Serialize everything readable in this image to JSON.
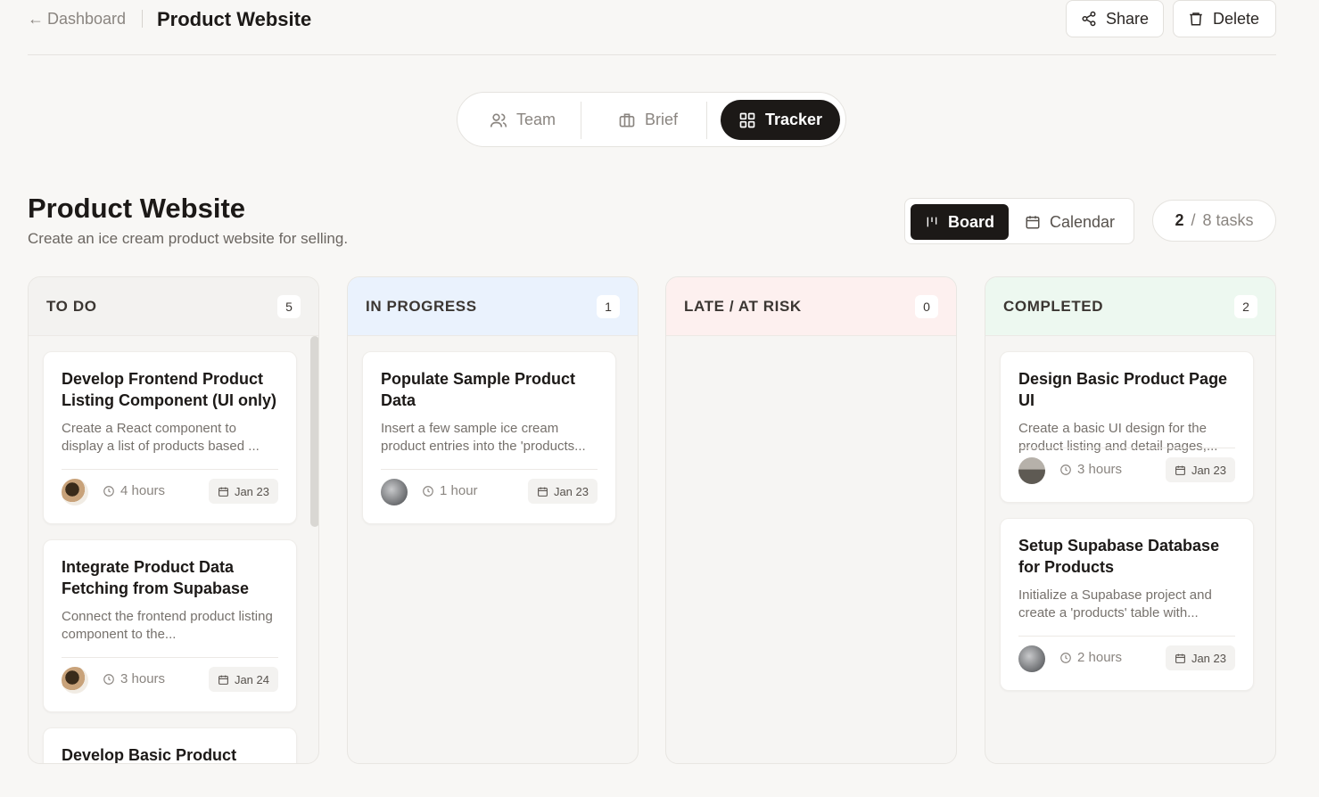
{
  "header": {
    "back_label": "Dashboard",
    "title": "Product Website",
    "share_label": "Share",
    "delete_label": "Delete"
  },
  "tabs": [
    {
      "label": "Team",
      "icon": "users-icon"
    },
    {
      "label": "Brief",
      "icon": "briefcase-icon"
    },
    {
      "label": "Tracker",
      "icon": "grid-icon",
      "active": true
    }
  ],
  "project": {
    "title": "Product Website",
    "description": "Create an ice cream product website for selling."
  },
  "views": {
    "board_label": "Board",
    "calendar_label": "Calendar",
    "active": "Board"
  },
  "task_count": {
    "done": "2",
    "separator": "/",
    "total": "8 tasks"
  },
  "columns": [
    {
      "title": "TO DO",
      "count": "5",
      "color": "#f3f2f0",
      "cards": [
        {
          "title": "Develop Frontend Product Listing Component (UI only)",
          "desc": "Create a React component to display a list of products based ...",
          "hours": "4 hours",
          "date": "Jan 23",
          "avatar": "food"
        },
        {
          "title": "Integrate Product Data Fetching from Supabase",
          "desc": "Connect the frontend product listing component to the...",
          "hours": "3 hours",
          "date": "Jan 24",
          "avatar": "food"
        },
        {
          "title": "Develop Basic Product Detail",
          "desc": "",
          "hours": "",
          "date": "",
          "avatar": ""
        }
      ]
    },
    {
      "title": "IN PROGRESS",
      "count": "1",
      "color": "#eaf2fd",
      "cards": [
        {
          "title": "Populate Sample Product Data",
          "desc": "Insert a few sample ice cream product entries into the 'products...",
          "hours": "1 hour",
          "date": "Jan 23",
          "avatar": "gray"
        }
      ]
    },
    {
      "title": "LATE / AT RISK",
      "count": "0",
      "color": "#fdf0ef",
      "cards": []
    },
    {
      "title": "COMPLETED",
      "count": "2",
      "color": "#edf8f0",
      "cards": [
        {
          "title": "Design Basic Product Page UI",
          "desc": "Create a basic UI design for the product listing and detail pages,...",
          "hours": "3 hours",
          "date": "Jan 23",
          "avatar": "land"
        },
        {
          "title": "Setup Supabase Database for Products",
          "desc": "Initialize a Supabase project and create a 'products' table with...",
          "hours": "2 hours",
          "date": "Jan 23",
          "avatar": "gray"
        }
      ]
    }
  ]
}
